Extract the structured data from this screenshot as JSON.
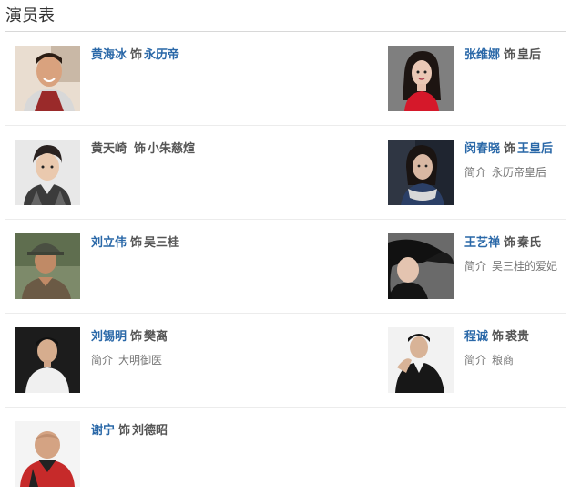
{
  "header": {
    "title": "演员表"
  },
  "intro_label": "简介",
  "as_word": "饰",
  "cast": [
    {
      "actor": "黄海冰",
      "role": "永历帝",
      "intro": "",
      "linked": true
    },
    {
      "actor": "张维娜",
      "role": "皇后",
      "intro": "",
      "linked": true
    },
    {
      "actor": "黄天崎",
      "role": "小朱慈煊",
      "intro": "",
      "linked": false
    },
    {
      "actor": "闵春晓",
      "role": "王皇后",
      "intro": "永历帝皇后",
      "linked": true
    },
    {
      "actor": "刘立伟",
      "role": "吴三桂",
      "intro": "",
      "linked": true
    },
    {
      "actor": "王艺禅",
      "role": "秦氏",
      "intro": "吴三桂的爱妃",
      "linked": true
    },
    {
      "actor": "刘锡明",
      "role": "樊离",
      "intro": "大明御医",
      "linked": true
    },
    {
      "actor": "程诚",
      "role": "裘贵",
      "intro": "粮商",
      "linked": true
    },
    {
      "actor": "谢宁",
      "role": "刘德昭",
      "intro": "",
      "linked": true
    }
  ]
}
